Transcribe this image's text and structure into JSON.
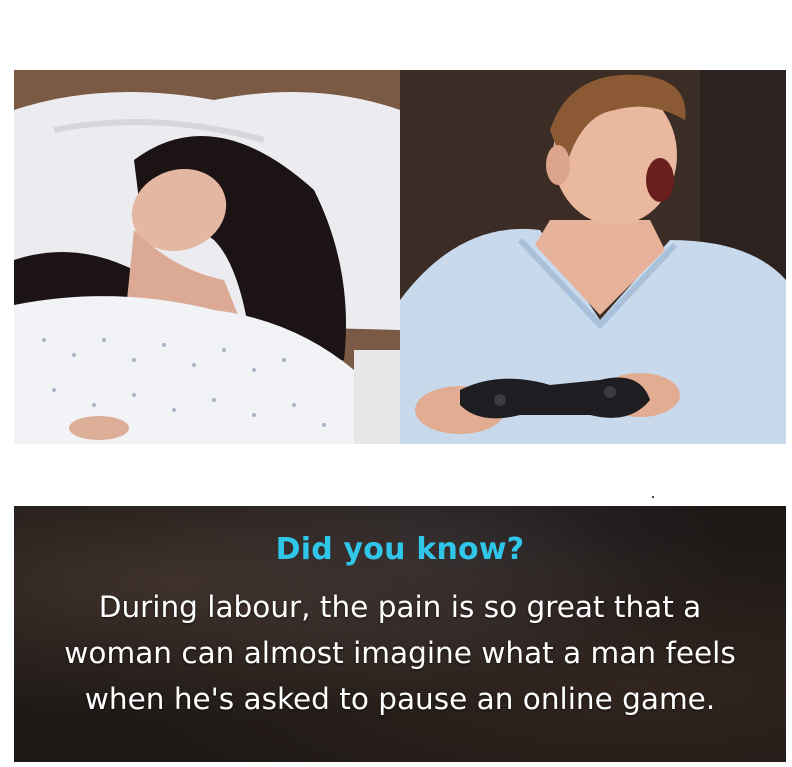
{
  "caption": {
    "heading": "Did you know?",
    "lines": [
      "During labour, the pain is so great that a",
      "woman can almost imagine what a man feels",
      "when he's asked to pause an online game."
    ]
  },
  "colors": {
    "heading": "#2fc6ea",
    "body_text": "#ffffff",
    "panel_bg": "#1d1816",
    "page_bg": "#ffffff"
  },
  "images": [
    {
      "name": "woman-in-labour-photo"
    },
    {
      "name": "man-gaming-photo"
    }
  ]
}
